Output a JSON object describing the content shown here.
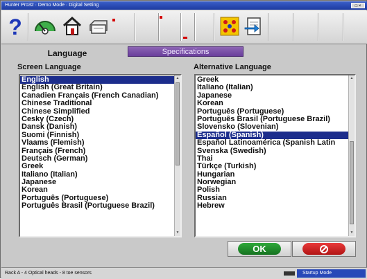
{
  "window": {
    "title": "Hunter Pro32 · Demo Mode · Digital Setting",
    "controls_label": "□ ×"
  },
  "toolbar": {
    "buttons": [
      {
        "icon": "help-icon"
      },
      {
        "icon": "alignment-icon"
      },
      {
        "icon": "home-icon"
      },
      {
        "icon": "printer-icon"
      },
      {
        "icon": "settings-grid-icon"
      },
      {
        "icon": "exit-icon"
      }
    ],
    "colors": {
      "help": "#1e38b8",
      "accent": "#d40000"
    }
  },
  "tabs": {
    "language": "Language",
    "specifications": "Specifications"
  },
  "screen_language": {
    "heading": "Screen Language",
    "items": [
      "English",
      "English (Great Britain)",
      "Canadien Français (French Canadian)",
      "Chinese Traditional",
      "Chinese Simplified",
      "Česky (Czech)",
      "Dansk (Danish)",
      "Suomi (Finnish)",
      "Vlaams (Flemish)",
      "Français (French)",
      "Deutsch (German)",
      "Greek",
      "Italiano (Italian)",
      "Japanese",
      "Korean",
      "Português (Portuguese)",
      "Português Brasil (Portuguese Brazil)"
    ],
    "selected": "English"
  },
  "alternative_language": {
    "heading": "Alternative Language",
    "items": [
      "Greek",
      "Italiano (Italian)",
      "Japanese",
      "Korean",
      "Português (Portuguese)",
      "Português Brasil (Portuguese Brazil)",
      "Slovensko (Slovenian)",
      "Español (Spanish)",
      "Español Latinoamérica (Spanish Latin",
      "Svenska (Swedish)",
      "Thai",
      "Türkçe (Turkish)",
      "Hungarian",
      "Norwegian",
      "Polish",
      "Russian",
      "Hebrew"
    ],
    "selected": "Español (Spanish)"
  },
  "buttons": {
    "ok": "OK",
    "cancel_icon": "cancel-icon"
  },
  "status": {
    "left": "Rack A - 4 Optical heads - 8 toe sensors",
    "right": "Startup Mode"
  }
}
